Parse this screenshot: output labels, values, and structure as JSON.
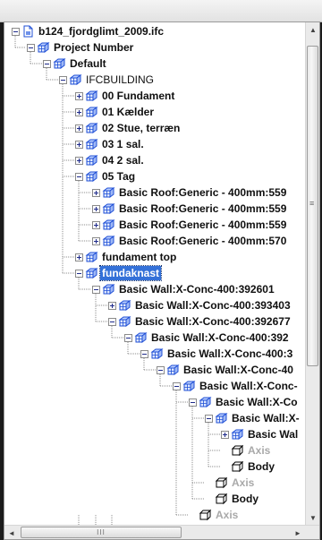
{
  "tree": {
    "root_label": "b124_fjordglimt_2009.ifc",
    "nodes": [
      "Project Number",
      "Default",
      "IFCBUILDING",
      "00 Fundament",
      "01 Kælder",
      "02 Stue, terræn",
      "03 1 sal.",
      "04 2 sal.",
      "05 Tag",
      "Basic Roof:Generic - 400mm:559",
      "Basic Roof:Generic - 400mm:559",
      "Basic Roof:Generic - 400mm:559",
      "Basic Roof:Generic - 400mm:570",
      "fundament top",
      "fundaknast",
      "Basic Wall:X-Conc-400:392601",
      "Basic Wall:X-Conc-400:393403",
      "Basic Wall:X-Conc-400:392677",
      "Basic Wall:X-Conc-400:392",
      "Basic Wall:X-Conc-400:3",
      "Basic Wall:X-Conc-40",
      "Basic Wall:X-Conc-",
      "Basic Wall:X-Co",
      "Basic Wall:X-",
      "Basic Wal",
      "Axis",
      "Body",
      "Axis",
      "Body",
      "Axis"
    ],
    "selected": "fundaknast"
  },
  "scrollbars": {
    "vertical": {
      "up_glyph": "▲",
      "down_glyph": "▼",
      "grip": "≡"
    },
    "horizontal": {
      "left_glyph": "◄",
      "right_glyph": "►",
      "grip": "III"
    }
  },
  "colors": {
    "selection": "#3471d8",
    "icon_blue": "#1f4fd6",
    "dim_text": "#a9a9a9"
  }
}
